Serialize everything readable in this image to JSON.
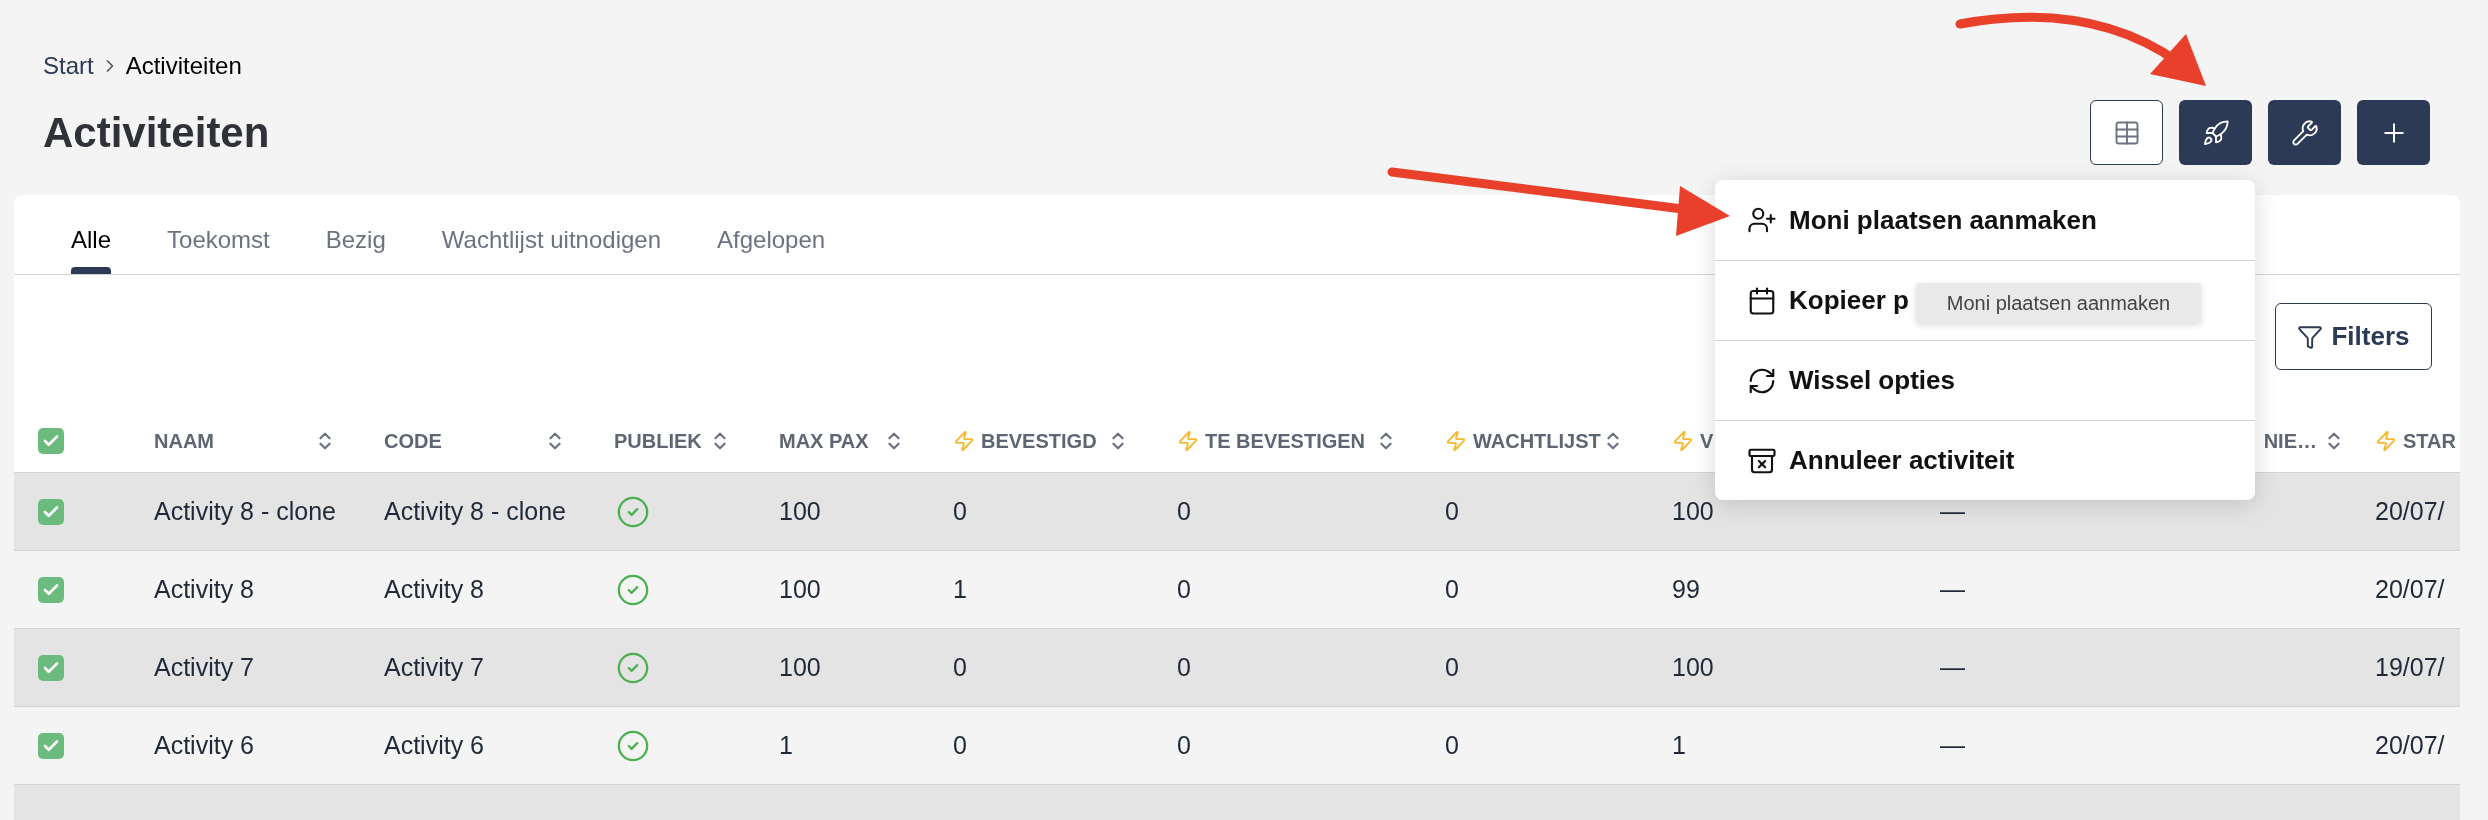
{
  "breadcrumb": [
    "Start",
    "Activiteiten"
  ],
  "title": "Activiteiten",
  "tabs": [
    {
      "label": "Alle",
      "selected": true
    },
    {
      "label": "Toekomst",
      "selected": false
    },
    {
      "label": "Bezig",
      "selected": false
    },
    {
      "label": "Wachtlijst uitnodigen",
      "selected": false
    },
    {
      "label": "Afgelopen",
      "selected": false
    }
  ],
  "filters_button": "Filters",
  "table": {
    "header_checked": true,
    "columns": [
      {
        "label": "NAAM",
        "bolt": false,
        "sortable": true
      },
      {
        "label": "CODE",
        "bolt": false,
        "sortable": true
      },
      {
        "label": "PUBLIEK",
        "bolt": false,
        "sortable": true
      },
      {
        "label": "MAX PAX",
        "bolt": false,
        "sortable": true
      },
      {
        "label": "BEVESTIGD",
        "bolt": true,
        "sortable": true
      },
      {
        "label": "TE BEVESTIGEN",
        "bolt": true,
        "sortable": true
      },
      {
        "label": "WACHTLIJST",
        "bolt": true,
        "sortable": true
      },
      {
        "label": "V",
        "bolt": true,
        "sortable": false
      },
      {
        "label": "NIE…",
        "bolt": false,
        "sortable": true
      },
      {
        "label": "STAR",
        "bolt": true,
        "sortable": false
      }
    ],
    "rows": [
      {
        "checked": true,
        "naam": "Activity 8 - clone",
        "code": "Activity 8 - clone",
        "publiek": true,
        "values": [
          "100",
          "0",
          "0",
          "0",
          "100",
          "—",
          "20/07/"
        ]
      },
      {
        "checked": true,
        "naam": "Activity 8",
        "code": "Activity 8",
        "publiek": true,
        "values": [
          "100",
          "1",
          "0",
          "0",
          "99",
          "—",
          "20/07/"
        ]
      },
      {
        "checked": true,
        "naam": "Activity 7",
        "code": "Activity 7",
        "publiek": true,
        "values": [
          "100",
          "0",
          "0",
          "0",
          "100",
          "—",
          "19/07/"
        ]
      },
      {
        "checked": true,
        "naam": "Activity 6",
        "code": "Activity 6",
        "publiek": true,
        "values": [
          "1",
          "0",
          "0",
          "0",
          "1",
          "—",
          "20/07/"
        ]
      }
    ]
  },
  "menu": [
    {
      "kind": "user-plus",
      "label": "Moni plaatsen aanmaken"
    },
    {
      "kind": "calendar",
      "label": "Kopieer p"
    },
    {
      "kind": "refresh",
      "label": "Wissel opties"
    },
    {
      "kind": "archive",
      "label": "Annuleer activiteit"
    }
  ],
  "tooltip": "Moni plaatsen aanmaken"
}
